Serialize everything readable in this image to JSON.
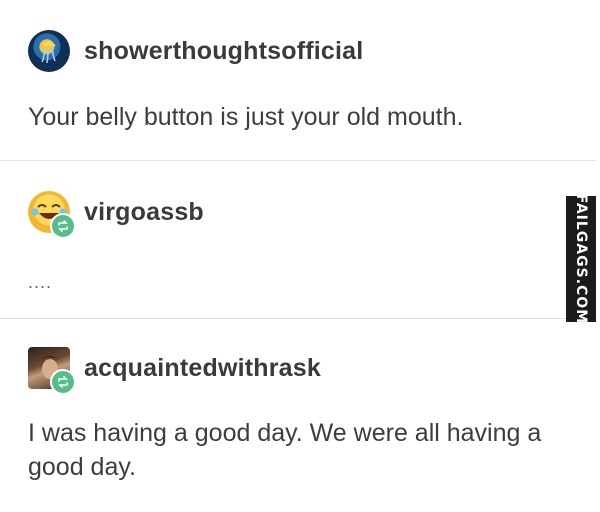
{
  "posts": [
    {
      "username": "showerthoughtsofficial",
      "text": "Your belly button is just your old mouth.",
      "avatar_icon": "jellyfish-avatar"
    },
    {
      "username": "virgoassb",
      "text": "....",
      "avatar_icon": "laughing-emoji-avatar",
      "badge_icon": "reblog-icon"
    },
    {
      "username": "acquaintedwithrask",
      "text": "I was having a good day. We were all having a good day.",
      "avatar_icon": "photo-avatar",
      "badge_icon": "reblog-icon"
    }
  ],
  "watermark": {
    "text": "FAILGAGS.COM"
  },
  "colors": {
    "reblog_badge": "#56bc8a",
    "watermark_bg": "#1b1b1b"
  }
}
